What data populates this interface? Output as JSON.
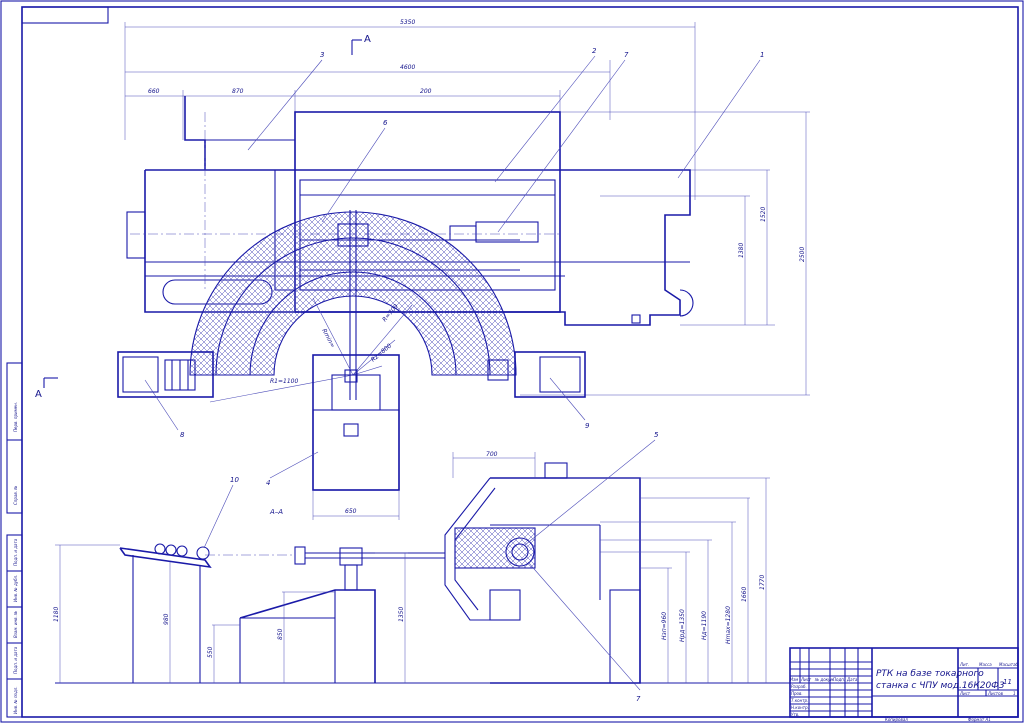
{
  "title_block": {
    "title_line1": "РТК на базе токарного",
    "title_line2": "станка с ЧПУ мод.16К20Ф3",
    "sheet_number": "11",
    "lit_label": "Лит.",
    "mass_label": "Масса",
    "scale_label": "Масштаб",
    "sheet_label": "Лист",
    "sheets_label": "Листов",
    "sheets_value": "1",
    "col_izm": "Изм",
    "col_list": "Лист",
    "col_doc": "№ докум.",
    "col_sign": "Подп.",
    "col_date": "Дата",
    "row_razrab": "Разраб.",
    "row_prov": "Пров.",
    "row_tkontr": "Т.контр.",
    "row_nkontr": "Н.контр.",
    "row_utv": "Утв.",
    "copied": "Копировал",
    "format": "Формат А1"
  },
  "side_stamp": [
    "Перв. примен.",
    "Справ. №",
    "Подп. и дата",
    "Инв. № дубл.",
    "Взам. инв. №",
    "Подп. и дата",
    "Инв. № подл."
  ],
  "section": {
    "mark": "А",
    "label": "А–А"
  },
  "positions": [
    "1",
    "2",
    "3",
    "4",
    "5",
    "6",
    "7",
    "8",
    "9",
    "10",
    "7"
  ],
  "dimensions": {
    "top_5350": "5350",
    "top_4600": "4600",
    "top_660": "660",
    "top_870": "870",
    "top_200": "200",
    "right_1380": "1380",
    "right_1520": "1520",
    "right_2500": "2500",
    "width_650": "650",
    "width_700": "700",
    "r_1100": "R1=1100",
    "r_rmin": "Rmin=",
    "r_700": "R=700",
    "r_800": "R2=800",
    "h_1180": "1180",
    "h_980": "980",
    "h_550": "550",
    "h_850": "850",
    "h_1350": "1350",
    "h_960": "Hзп=960",
    "h_1350b": "Hрд=1350",
    "h_1190": "Hд=1190",
    "h_1280": "Hmax=1280",
    "h_1660": "1660",
    "h_1770": "1770"
  }
}
